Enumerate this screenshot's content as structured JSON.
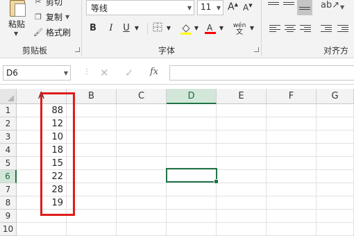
{
  "ribbon": {
    "clipboard": {
      "paste_label": "粘贴",
      "cut_label": "剪切",
      "copy_label": "复制",
      "format_painter_label": "格式刷",
      "group_label": "剪贴板"
    },
    "font": {
      "font_name": "等线",
      "font_size": "11",
      "grow_label": "A",
      "shrink_label": "A",
      "bold_label": "B",
      "italic_label": "I",
      "underline_label": "U",
      "phonetic_label": "wén",
      "group_label": "字体"
    },
    "alignment": {
      "group_label": "对齐方式"
    },
    "colors": {
      "fill_color": "#ffff00",
      "font_color": "#ff0000",
      "accent": "#217346",
      "highlight_border": "#e01b1b"
    }
  },
  "formula_bar": {
    "name_box": "D6",
    "cancel_icon": "✕",
    "enter_icon": "✓",
    "fx_label": "fx",
    "formula": ""
  },
  "sheet": {
    "columns": [
      "A",
      "B",
      "C",
      "D",
      "E",
      "F",
      "G"
    ],
    "selected_column": "D",
    "rows": [
      "1",
      "2",
      "3",
      "4",
      "5",
      "6",
      "7",
      "8",
      "9",
      "10"
    ],
    "selected_row": "6",
    "column_a_values": [
      "88",
      "12",
      "10",
      "18",
      "15",
      "22",
      "28",
      "19",
      "",
      ""
    ],
    "active_cell": "D6"
  }
}
